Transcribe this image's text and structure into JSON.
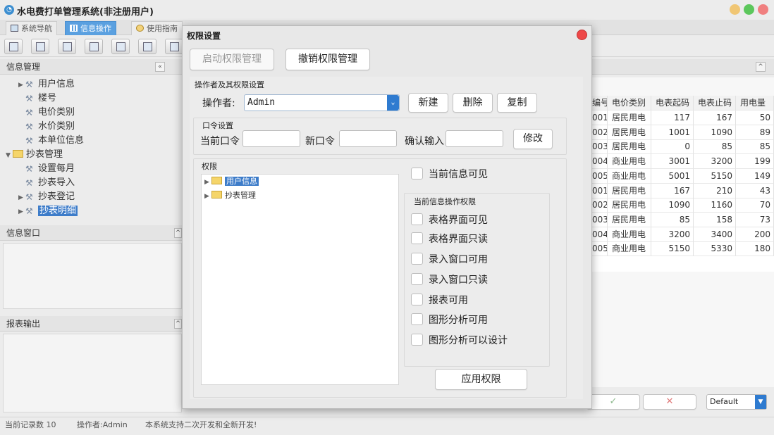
{
  "app": {
    "title": "水电费打单管理系统(非注册用户)",
    "window_buttons": {
      "minimize_color": "#f0c674",
      "maximize_color": "#5cc75c",
      "close_color": "#f07f7f"
    }
  },
  "tabs": [
    {
      "label": "系统导航",
      "icon": "monitor-icon",
      "active": false
    },
    {
      "label": "信息操作",
      "icon": "grid-icon",
      "active": true
    },
    {
      "label": "使用指南",
      "icon": "compass-icon",
      "active": false
    }
  ],
  "sidebar": {
    "header": "信息管理",
    "tree": [
      {
        "label": "用户信息",
        "expandable": true,
        "level": 1,
        "icon": "wrench-icon",
        "selected": false
      },
      {
        "label": "楼号",
        "expandable": false,
        "level": 1,
        "icon": "wrench-icon",
        "selected": false
      },
      {
        "label": "电价类别",
        "expandable": false,
        "level": 1,
        "icon": "wrench-icon",
        "selected": false
      },
      {
        "label": "水价类别",
        "expandable": false,
        "level": 1,
        "icon": "wrench-icon",
        "selected": false
      },
      {
        "label": "本单位信息",
        "expandable": false,
        "level": 1,
        "icon": "wrench-icon",
        "selected": false
      },
      {
        "label": "抄表管理",
        "expandable": true,
        "expanded": true,
        "level": 0,
        "icon": "folder-icon",
        "selected": false
      },
      {
        "label": "设置每月",
        "expandable": false,
        "level": 1,
        "icon": "wrench-icon",
        "selected": false
      },
      {
        "label": "抄表导入",
        "expandable": false,
        "level": 1,
        "icon": "wrench-icon",
        "selected": false
      },
      {
        "label": "抄表登记",
        "expandable": true,
        "level": 1,
        "icon": "wrench-icon",
        "selected": false
      },
      {
        "label": "抄表明细",
        "expandable": true,
        "level": 1,
        "icon": "wrench-icon",
        "selected": true
      }
    ],
    "info_window_header": "信息窗口",
    "report_output_header": "报表输出"
  },
  "grid": {
    "columns": [
      "编号",
      "电价类别",
      "电表起码",
      "电表止码",
      "用电量"
    ],
    "rows": [
      [
        "001",
        "居民用电",
        "117",
        "167",
        "50"
      ],
      [
        "002",
        "居民用电",
        "1001",
        "1090",
        "89"
      ],
      [
        "003",
        "居民用电",
        "0",
        "85",
        "85"
      ],
      [
        "004",
        "商业用电",
        "3001",
        "3200",
        "199"
      ],
      [
        "005",
        "商业用电",
        "5001",
        "5150",
        "149"
      ],
      [
        "001",
        "居民用电",
        "167",
        "210",
        "43"
      ],
      [
        "002",
        "居民用电",
        "1090",
        "1160",
        "70"
      ],
      [
        "003",
        "居民用电",
        "85",
        "158",
        "73"
      ],
      [
        "004",
        "商业用电",
        "3200",
        "3400",
        "200"
      ],
      [
        "005",
        "商业用电",
        "5150",
        "5330",
        "180"
      ]
    ],
    "confirm_glyph": "✓",
    "cancel_glyph": "✕",
    "style_select_value": "Default"
  },
  "status": {
    "record_count": "当前记录数 10",
    "operator": "操作者:Admin",
    "notice": "本系统支持二次开发和全新开发!"
  },
  "dialog": {
    "title": "权限设置",
    "enable_button": "启动权限管理",
    "revoke_button": "撤销权限管理",
    "operator_group": "操作者及其权限设置",
    "operator_label": "操作者:",
    "operator_value": "Admin",
    "new_button": "新建",
    "delete_button": "删除",
    "copy_button": "复制",
    "password_group": "口令设置",
    "current_password_label": "当前口令",
    "new_password_label": "新口令",
    "confirm_password_label": "确认输入",
    "modify_button": "修改",
    "permission_group": "权限",
    "permission_tree": [
      {
        "label": "用户信息",
        "selected": true
      },
      {
        "label": "抄表管理",
        "selected": false
      }
    ],
    "info_visible_label": "当前信息可见",
    "ops_group": "当前信息操作权限",
    "checkboxes": [
      "表格界面可见",
      "表格界面只读",
      "录入窗口可用",
      "录入窗口只读",
      "报表可用",
      "图形分析可用",
      "图形分析可以设计"
    ],
    "apply_button": "应用权限"
  }
}
